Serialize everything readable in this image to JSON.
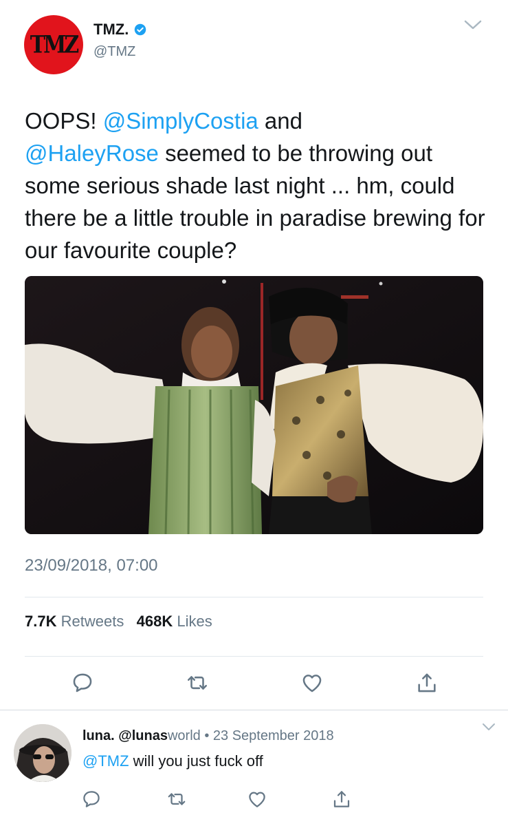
{
  "tweet": {
    "author_name": "TMZ.",
    "author_handle": "@TMZ",
    "avatar_logo": "TMZ",
    "text_parts": {
      "p1": "OOPS! ",
      "m1": "@SimplyCostia",
      "p2": " and ",
      "m2": "@HaleyRose",
      "p3": " seemed to be throwing out some serious shade last night ... hm, could there be a little trouble in paradise brewing for our favourite couple?"
    },
    "timestamp": "23/09/2018, 07:00",
    "retweets_count": "7.7K",
    "retweets_label": "Retweets",
    "likes_count": "468K",
    "likes_label": "Likes",
    "actions": [
      "reply-icon",
      "retweet-icon",
      "like-icon",
      "share-icon"
    ]
  },
  "reply": {
    "name": "luna.",
    "handle_bold": "@lunas",
    "handle_rest": "world",
    "separator": " • ",
    "date": "23 September 2018",
    "mention": "@TMZ",
    "text": " will you just fuck off",
    "actions": [
      "reply-icon",
      "retweet-icon",
      "like-icon",
      "share-icon"
    ]
  },
  "colors": {
    "accent": "#1da1f2",
    "secondary_text": "#657786",
    "primary_text": "#14171a",
    "avatar_red": "#e1141c"
  }
}
